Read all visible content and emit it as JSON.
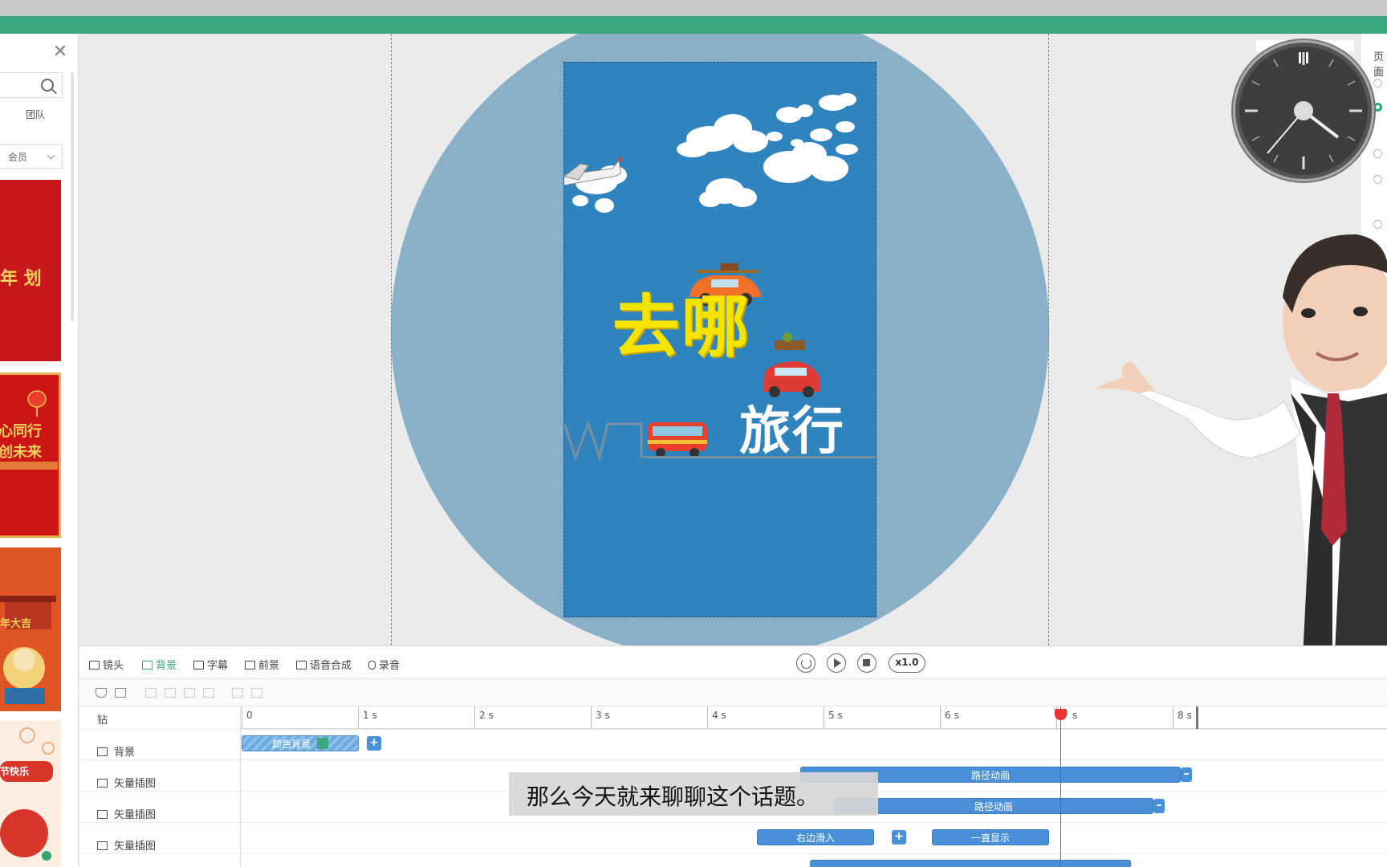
{
  "left_panel": {
    "team_label": "团队",
    "member_select": "会员",
    "thumb1_text": "年 划",
    "thumb2_line1": "心同行",
    "thumb2_line2": "创未来",
    "thumb3_text": "年大吉",
    "thumb4_text": "节快乐"
  },
  "poster": {
    "title_main": "去哪",
    "title_sub": "旅行"
  },
  "toolbar": {
    "tools": [
      "镜头",
      "背景",
      "字幕",
      "前景",
      "语音合成",
      "录音"
    ],
    "active_tool": "背景",
    "speed": "x1.0"
  },
  "timeline": {
    "ruler_labels": [
      "0",
      "1 s",
      "2 s",
      "3 s",
      "4 s",
      "5 s",
      "6 s",
      "s",
      "8 s"
    ],
    "header_label": "钻",
    "tracks": [
      {
        "label": "背景"
      },
      {
        "label": "矢量插图"
      },
      {
        "label": "矢量插图"
      },
      {
        "label": "矢量插图"
      }
    ],
    "clips": {
      "bg_color": "颜色背景",
      "path_anim_1": "路径动画",
      "path_anim_2": "路径动画",
      "slide_in_right": "右边滑入",
      "always_show": "一直显示"
    }
  },
  "subtitle": "那么今天就来聊聊这个话题。",
  "right_strip": {
    "label": "页面"
  },
  "colors": {
    "accent": "#2fa573",
    "green_bar": "#3aa77f",
    "poster_blue": "#2f84be",
    "circle_blue": "#8ab0c8",
    "clip_blue": "#4a90d9",
    "playhead": "#e33333"
  },
  "icons": [
    "close-icon",
    "search-icon",
    "chevron-down-icon",
    "replay-icon",
    "play-icon",
    "stop-icon",
    "filter-icon",
    "clock-icon"
  ]
}
